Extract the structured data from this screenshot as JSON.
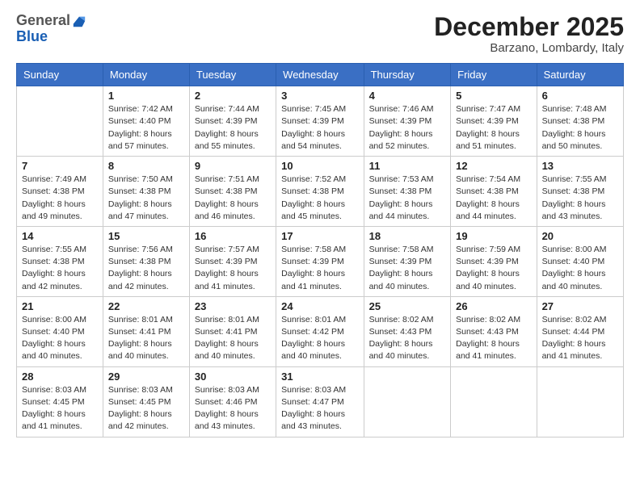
{
  "header": {
    "logo_general": "General",
    "logo_blue": "Blue",
    "month_title": "December 2025",
    "location": "Barzano, Lombardy, Italy"
  },
  "weekdays": [
    "Sunday",
    "Monday",
    "Tuesday",
    "Wednesday",
    "Thursday",
    "Friday",
    "Saturday"
  ],
  "weeks": [
    [
      {
        "day": "",
        "info": ""
      },
      {
        "day": "1",
        "info": "Sunrise: 7:42 AM\nSunset: 4:40 PM\nDaylight: 8 hours\nand 57 minutes."
      },
      {
        "day": "2",
        "info": "Sunrise: 7:44 AM\nSunset: 4:39 PM\nDaylight: 8 hours\nand 55 minutes."
      },
      {
        "day": "3",
        "info": "Sunrise: 7:45 AM\nSunset: 4:39 PM\nDaylight: 8 hours\nand 54 minutes."
      },
      {
        "day": "4",
        "info": "Sunrise: 7:46 AM\nSunset: 4:39 PM\nDaylight: 8 hours\nand 52 minutes."
      },
      {
        "day": "5",
        "info": "Sunrise: 7:47 AM\nSunset: 4:39 PM\nDaylight: 8 hours\nand 51 minutes."
      },
      {
        "day": "6",
        "info": "Sunrise: 7:48 AM\nSunset: 4:38 PM\nDaylight: 8 hours\nand 50 minutes."
      }
    ],
    [
      {
        "day": "7",
        "info": "Sunrise: 7:49 AM\nSunset: 4:38 PM\nDaylight: 8 hours\nand 49 minutes."
      },
      {
        "day": "8",
        "info": "Sunrise: 7:50 AM\nSunset: 4:38 PM\nDaylight: 8 hours\nand 47 minutes."
      },
      {
        "day": "9",
        "info": "Sunrise: 7:51 AM\nSunset: 4:38 PM\nDaylight: 8 hours\nand 46 minutes."
      },
      {
        "day": "10",
        "info": "Sunrise: 7:52 AM\nSunset: 4:38 PM\nDaylight: 8 hours\nand 45 minutes."
      },
      {
        "day": "11",
        "info": "Sunrise: 7:53 AM\nSunset: 4:38 PM\nDaylight: 8 hours\nand 44 minutes."
      },
      {
        "day": "12",
        "info": "Sunrise: 7:54 AM\nSunset: 4:38 PM\nDaylight: 8 hours\nand 44 minutes."
      },
      {
        "day": "13",
        "info": "Sunrise: 7:55 AM\nSunset: 4:38 PM\nDaylight: 8 hours\nand 43 minutes."
      }
    ],
    [
      {
        "day": "14",
        "info": "Sunrise: 7:55 AM\nSunset: 4:38 PM\nDaylight: 8 hours\nand 42 minutes."
      },
      {
        "day": "15",
        "info": "Sunrise: 7:56 AM\nSunset: 4:38 PM\nDaylight: 8 hours\nand 42 minutes."
      },
      {
        "day": "16",
        "info": "Sunrise: 7:57 AM\nSunset: 4:39 PM\nDaylight: 8 hours\nand 41 minutes."
      },
      {
        "day": "17",
        "info": "Sunrise: 7:58 AM\nSunset: 4:39 PM\nDaylight: 8 hours\nand 41 minutes."
      },
      {
        "day": "18",
        "info": "Sunrise: 7:58 AM\nSunset: 4:39 PM\nDaylight: 8 hours\nand 40 minutes."
      },
      {
        "day": "19",
        "info": "Sunrise: 7:59 AM\nSunset: 4:39 PM\nDaylight: 8 hours\nand 40 minutes."
      },
      {
        "day": "20",
        "info": "Sunrise: 8:00 AM\nSunset: 4:40 PM\nDaylight: 8 hours\nand 40 minutes."
      }
    ],
    [
      {
        "day": "21",
        "info": "Sunrise: 8:00 AM\nSunset: 4:40 PM\nDaylight: 8 hours\nand 40 minutes."
      },
      {
        "day": "22",
        "info": "Sunrise: 8:01 AM\nSunset: 4:41 PM\nDaylight: 8 hours\nand 40 minutes."
      },
      {
        "day": "23",
        "info": "Sunrise: 8:01 AM\nSunset: 4:41 PM\nDaylight: 8 hours\nand 40 minutes."
      },
      {
        "day": "24",
        "info": "Sunrise: 8:01 AM\nSunset: 4:42 PM\nDaylight: 8 hours\nand 40 minutes."
      },
      {
        "day": "25",
        "info": "Sunrise: 8:02 AM\nSunset: 4:43 PM\nDaylight: 8 hours\nand 40 minutes."
      },
      {
        "day": "26",
        "info": "Sunrise: 8:02 AM\nSunset: 4:43 PM\nDaylight: 8 hours\nand 41 minutes."
      },
      {
        "day": "27",
        "info": "Sunrise: 8:02 AM\nSunset: 4:44 PM\nDaylight: 8 hours\nand 41 minutes."
      }
    ],
    [
      {
        "day": "28",
        "info": "Sunrise: 8:03 AM\nSunset: 4:45 PM\nDaylight: 8 hours\nand 41 minutes."
      },
      {
        "day": "29",
        "info": "Sunrise: 8:03 AM\nSunset: 4:45 PM\nDaylight: 8 hours\nand 42 minutes."
      },
      {
        "day": "30",
        "info": "Sunrise: 8:03 AM\nSunset: 4:46 PM\nDaylight: 8 hours\nand 43 minutes."
      },
      {
        "day": "31",
        "info": "Sunrise: 8:03 AM\nSunset: 4:47 PM\nDaylight: 8 hours\nand 43 minutes."
      },
      {
        "day": "",
        "info": ""
      },
      {
        "day": "",
        "info": ""
      },
      {
        "day": "",
        "info": ""
      }
    ]
  ]
}
